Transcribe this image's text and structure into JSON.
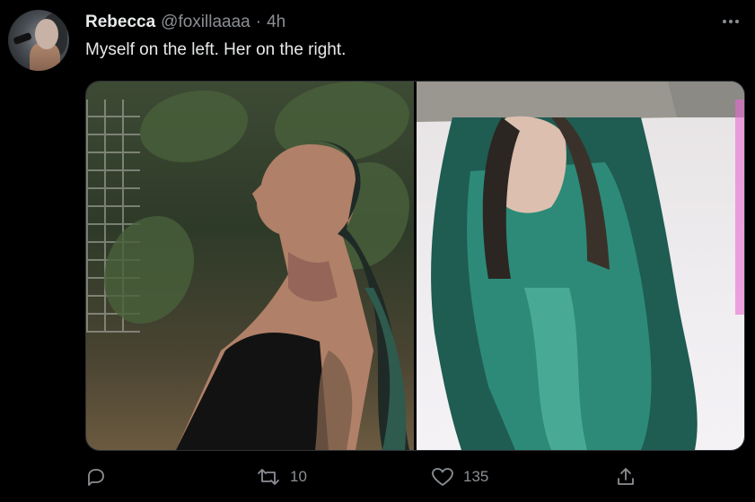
{
  "tweet": {
    "author_name": "Rebecca",
    "handle": "@foxillaaaa",
    "separator": "·",
    "time": "4h",
    "text": "Myself on the left. Her on the right."
  },
  "media": [
    {
      "position": "left",
      "description_icon": "photo-icon"
    },
    {
      "position": "right",
      "description_icon": "photo-icon"
    }
  ],
  "actions": {
    "reply_count": "",
    "retweet_count": "10",
    "like_count": "135",
    "share_count": ""
  },
  "colors": {
    "background": "#000000",
    "text_primary": "#e7e9ea",
    "text_secondary": "#8b8f94"
  }
}
